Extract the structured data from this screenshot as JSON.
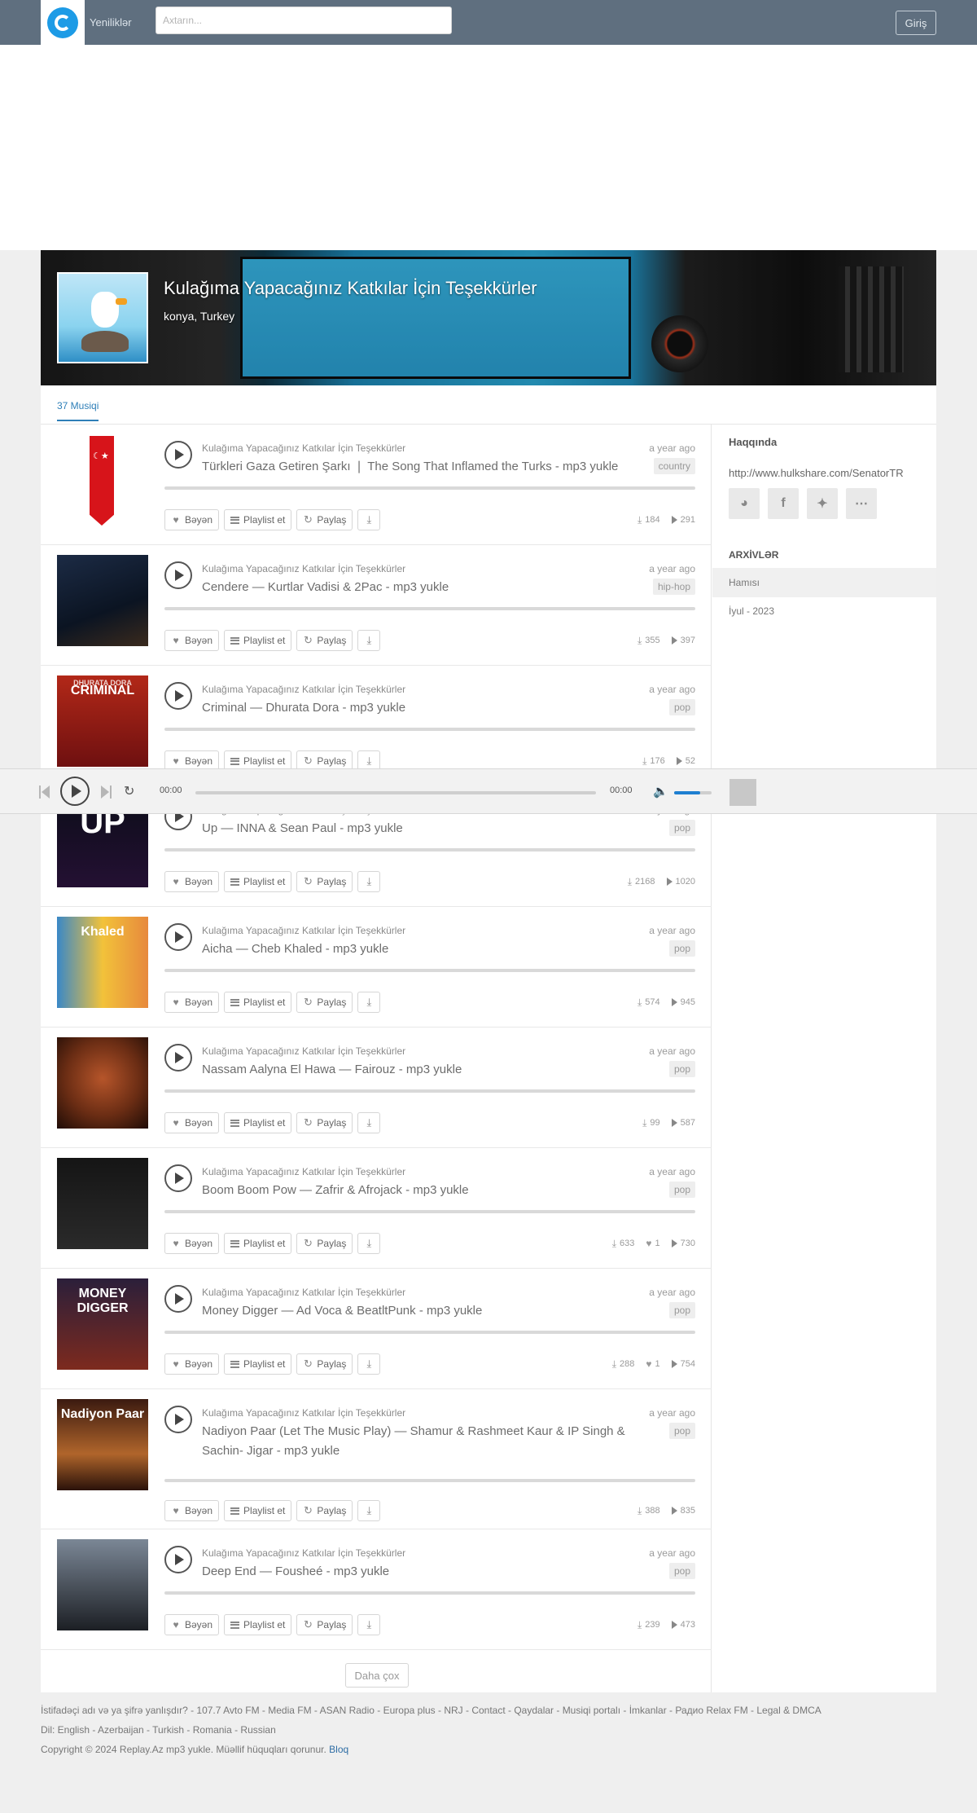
{
  "header": {
    "nav_label": "Yeniliklər",
    "search_placeholder": "Axtarın...",
    "login_label": "Giriş"
  },
  "banner": {
    "title": "Kulağıma Yapacağınız Katkılar İçin Teşekkürler",
    "location": "konya, Turkey"
  },
  "tabs": {
    "music_count": "37 Musiqi"
  },
  "track_actions": {
    "like": "Bəyən",
    "playlist": "Playlist et",
    "share": "Paylaş"
  },
  "tracks": [
    {
      "artist": "Kulağıma Yapacağınız Katkılar İçin Teşekkürler",
      "title": "Türkleri Gaza Getiren Şarkı ❘ The Song That Inflamed the Turks - mp3 yukle",
      "time": "a year ago",
      "genre": "country",
      "downloads": "184",
      "likes": "",
      "plays": "291"
    },
    {
      "artist": "Kulağıma Yapacağınız Katkılar İçin Teşekkürler",
      "title": "Cendere — Kurtlar Vadisi & 2Pac - mp3 yukle",
      "time": "a year ago",
      "genre": "hip-hop",
      "downloads": "355",
      "likes": "",
      "plays": "397"
    },
    {
      "artist": "Kulağıma Yapacağınız Katkılar İçin Teşekkürler",
      "title": "Criminal — Dhurata Dora - mp3 yukle",
      "time": "a year ago",
      "genre": "pop",
      "downloads": "176",
      "likes": "",
      "plays": "52",
      "cover_text": "CRIMINAL",
      "cover_sub": "DHURATA DORA"
    },
    {
      "artist": "Kulağıma Yapacağınız Katkılar İçin Teşekkürler",
      "title": "Up — INNA & Sean Paul - mp3 yukle",
      "time": "a year ago",
      "genre": "pop",
      "downloads": "2168",
      "likes": "",
      "plays": "1020",
      "cover_text": "UP"
    },
    {
      "artist": "Kulağıma Yapacağınız Katkılar İçin Teşekkürler",
      "title": "Aicha — Cheb Khaled - mp3 yukle",
      "time": "a year ago",
      "genre": "pop",
      "downloads": "574",
      "likes": "",
      "plays": "945",
      "cover_text": "Khaled"
    },
    {
      "artist": "Kulağıma Yapacağınız Katkılar İçin Teşekkürler",
      "title": "Nassam Aalyna El Hawa — Fairouz - mp3 yukle",
      "time": "a year ago",
      "genre": "pop",
      "downloads": "99",
      "likes": "",
      "plays": "587"
    },
    {
      "artist": "Kulağıma Yapacağınız Katkılar İçin Teşekkürler",
      "title": "Boom Boom Pow — Zafrir & Afrojack - mp3 yukle",
      "time": "a year ago",
      "genre": "pop",
      "downloads": "633",
      "likes": "1",
      "plays": "730"
    },
    {
      "artist": "Kulağıma Yapacağınız Katkılar İçin Teşekkürler",
      "title": "Money Digger — Ad Voca & BeatltPunk - mp3 yukle",
      "time": "a year ago",
      "genre": "pop",
      "downloads": "288",
      "likes": "1",
      "plays": "754",
      "cover_text": "MONEY DIGGER"
    },
    {
      "artist": "Kulağıma Yapacağınız Katkılar İçin Teşekkürler",
      "title": "Nadiyon Paar (Let The Music Play) — Shamur & Rashmeet Kaur & IP Singh & Sachin- Jigar - mp3 yukle",
      "time": "a year ago",
      "genre": "pop",
      "downloads": "388",
      "likes": "",
      "plays": "835",
      "cover_text": "Nadiyon Paar"
    },
    {
      "artist": "Kulağıma Yapacağınız Katkılar İçin Teşekkürler",
      "title": "Deep End — Fousheé - mp3 yukle",
      "time": "a year ago",
      "genre": "pop",
      "downloads": "239",
      "likes": "",
      "plays": "473"
    }
  ],
  "load_more_label": "Daha çox",
  "sidebar": {
    "about_heading": "Haqqında",
    "link": "http://www.hulkshare.com/SenatorTR",
    "archives_heading": "ARXİVLƏR",
    "archive_items": [
      "Hamısı",
      "İyul - 2023"
    ]
  },
  "player": {
    "current_time": "00:00",
    "duration": "00:00",
    "volume": 0.7
  },
  "footer": {
    "line1": "İstifadəçi adı və ya şifrə yanlışdır? - 107.7 Avto FM - Media FM - ASAN Radio - Europa plus - NRJ - Contact - Qaydalar - Musiqi portalı - İmkanlar - Радио Relax FM - Legal & DMCA",
    "line2": "Dil: English - Azerbaijan - Turkish - Romania - Russian",
    "line3": "Copyright © 2024 Replay.Az mp3 yukle. Müəllif hüquqları qorunur.",
    "blog": "Bloq"
  },
  "colors": {
    "header_bg": "#5f6f7f",
    "accent": "#2e7fb8",
    "volume_fill": "#1e7fd1"
  }
}
